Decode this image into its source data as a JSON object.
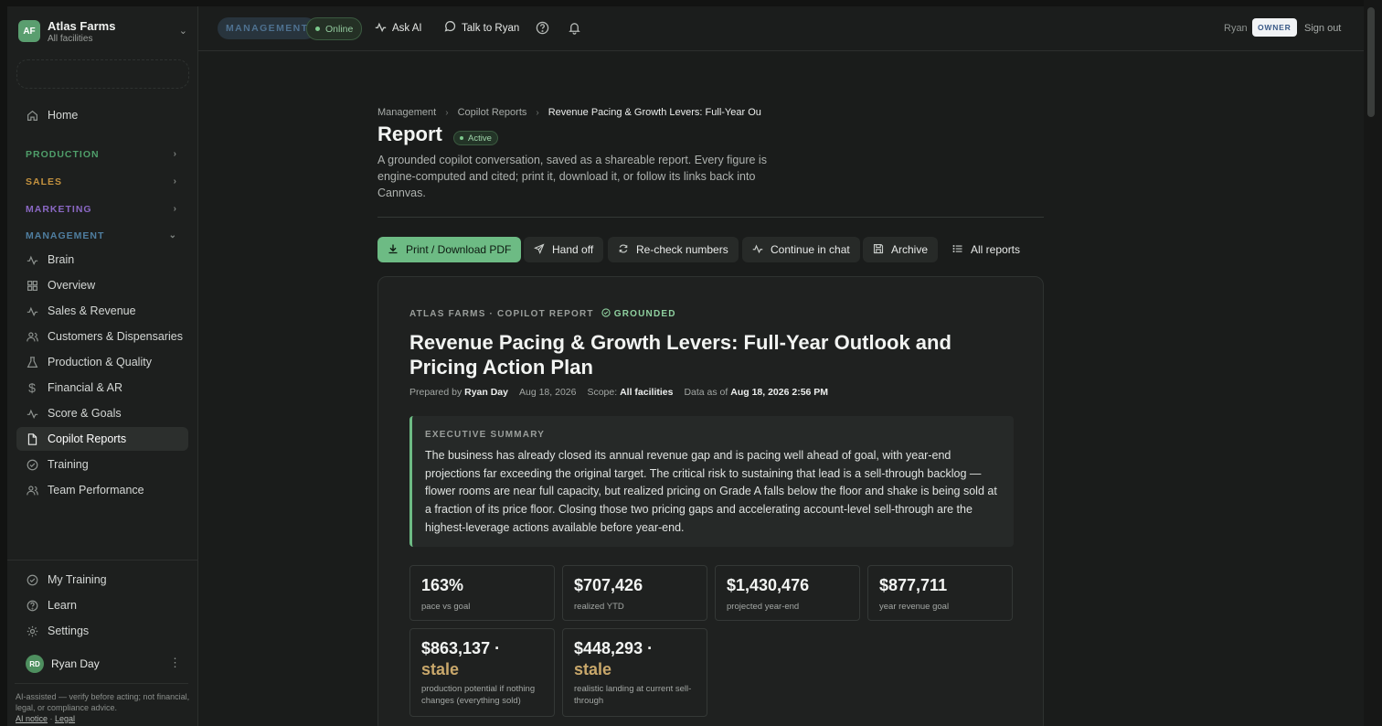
{
  "org": {
    "initials": "AF",
    "name": "Atlas Farms",
    "scope": "All facilities"
  },
  "sidebar": {
    "home": "Home",
    "sections": {
      "production": "PRODUCTION",
      "sales": "SALES",
      "marketing": "MARKETING",
      "management": "MANAGEMENT"
    },
    "management_items": [
      "Brain",
      "Overview",
      "Sales & Revenue",
      "Customers & Dispensaries",
      "Production & Quality",
      "Financial & AR",
      "Score & Goals",
      "Copilot Reports",
      "Training",
      "Team Performance"
    ],
    "bottom_items": [
      "My Training",
      "Learn",
      "Settings"
    ],
    "user": {
      "initials": "RD",
      "name": "Ryan Day"
    },
    "disclaimer": "AI-assisted — verify before acting; not financial, legal, or compliance advice.",
    "ai_notice": "AI notice",
    "legal": "Legal"
  },
  "topbar": {
    "mode": "MANAGEMENT",
    "status": "Online",
    "ask_ai": "Ask AI",
    "talk": "Talk to Ryan",
    "user": "Ryan",
    "role": "OWNER",
    "sign_out": "Sign out"
  },
  "breadcrumb": [
    "Management",
    "Copilot Reports",
    "Revenue Pacing & Growth Levers: Full-Year Ou"
  ],
  "page": {
    "title": "Report",
    "status": "Active",
    "description": "A grounded copilot conversation, saved as a shareable report. Every figure is engine-computed and cited; print it, download it, or follow its links back into Cannvas."
  },
  "actions": [
    "Print / Download PDF",
    "Hand off",
    "Re-check numbers",
    "Continue in chat",
    "Archive",
    "All reports"
  ],
  "report": {
    "kicker": "ATLAS FARMS · COPILOT REPORT",
    "grounded": "GROUNDED",
    "title": "Revenue Pacing & Growth Levers: Full-Year Outlook and Pricing Action Plan",
    "meta": {
      "prepared_label": "Prepared by",
      "prepared_by": "Ryan Day",
      "date": "Aug 18, 2026",
      "scope_label": "Scope:",
      "scope": "All facilities",
      "data_label": "Data as of",
      "data_as_of": "Aug 18, 2026 2:56 PM"
    },
    "summary_label": "EXECUTIVE SUMMARY",
    "summary": "The business has already closed its annual revenue gap and is pacing well ahead of goal, with year-end projections far exceeding the original target. The critical risk to sustaining that lead is a sell-through backlog — flower rooms are near full capacity, but realized pricing on Grade A falls below the floor and shake is being sold at a fraction of its price floor. Closing those two pricing gaps and accelerating account-level sell-through are the highest-leverage actions available before year-end.",
    "stats": [
      {
        "value": "163%",
        "label": "pace vs goal"
      },
      {
        "value": "$707,426",
        "label": "realized YTD"
      },
      {
        "value": "$1,430,476",
        "label": "projected year-end"
      },
      {
        "value": "$877,711",
        "label": "year revenue goal"
      },
      {
        "value": "$863,137 ·",
        "flag": "stale",
        "label": "production potential if nothing changes (everything sold)"
      },
      {
        "value": "$448,293 ·",
        "flag": "stale",
        "label": "realistic landing at current sell-through"
      }
    ]
  },
  "colors": {
    "accent": "#6dbb84",
    "production": "#4f9e6a",
    "sales": "#c4923f",
    "marketing": "#8a68c4",
    "management": "#4f7ea0",
    "stale": "#c9a86b"
  }
}
